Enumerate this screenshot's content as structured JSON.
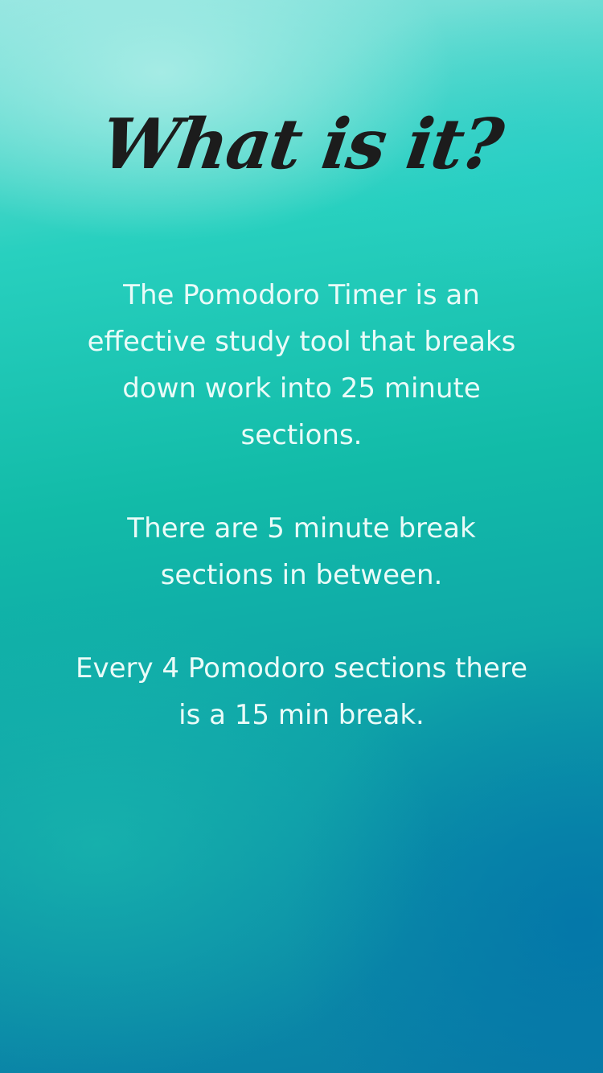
{
  "title": "What is it?",
  "paragraphs": [
    "The Pomodoro Timer is an effective study tool that breaks down work into 25 minute sections.",
    "There are 5 minute break sections in between.",
    "Every 4 Pomodoro sections there is a 15 min break."
  ],
  "colors": {
    "title_text": "#1c1c1c",
    "body_text": "#eafbf8",
    "gradient_top": "#8fe4df",
    "gradient_middle": "#12bba8",
    "gradient_bottom": "#0a7fa6"
  }
}
